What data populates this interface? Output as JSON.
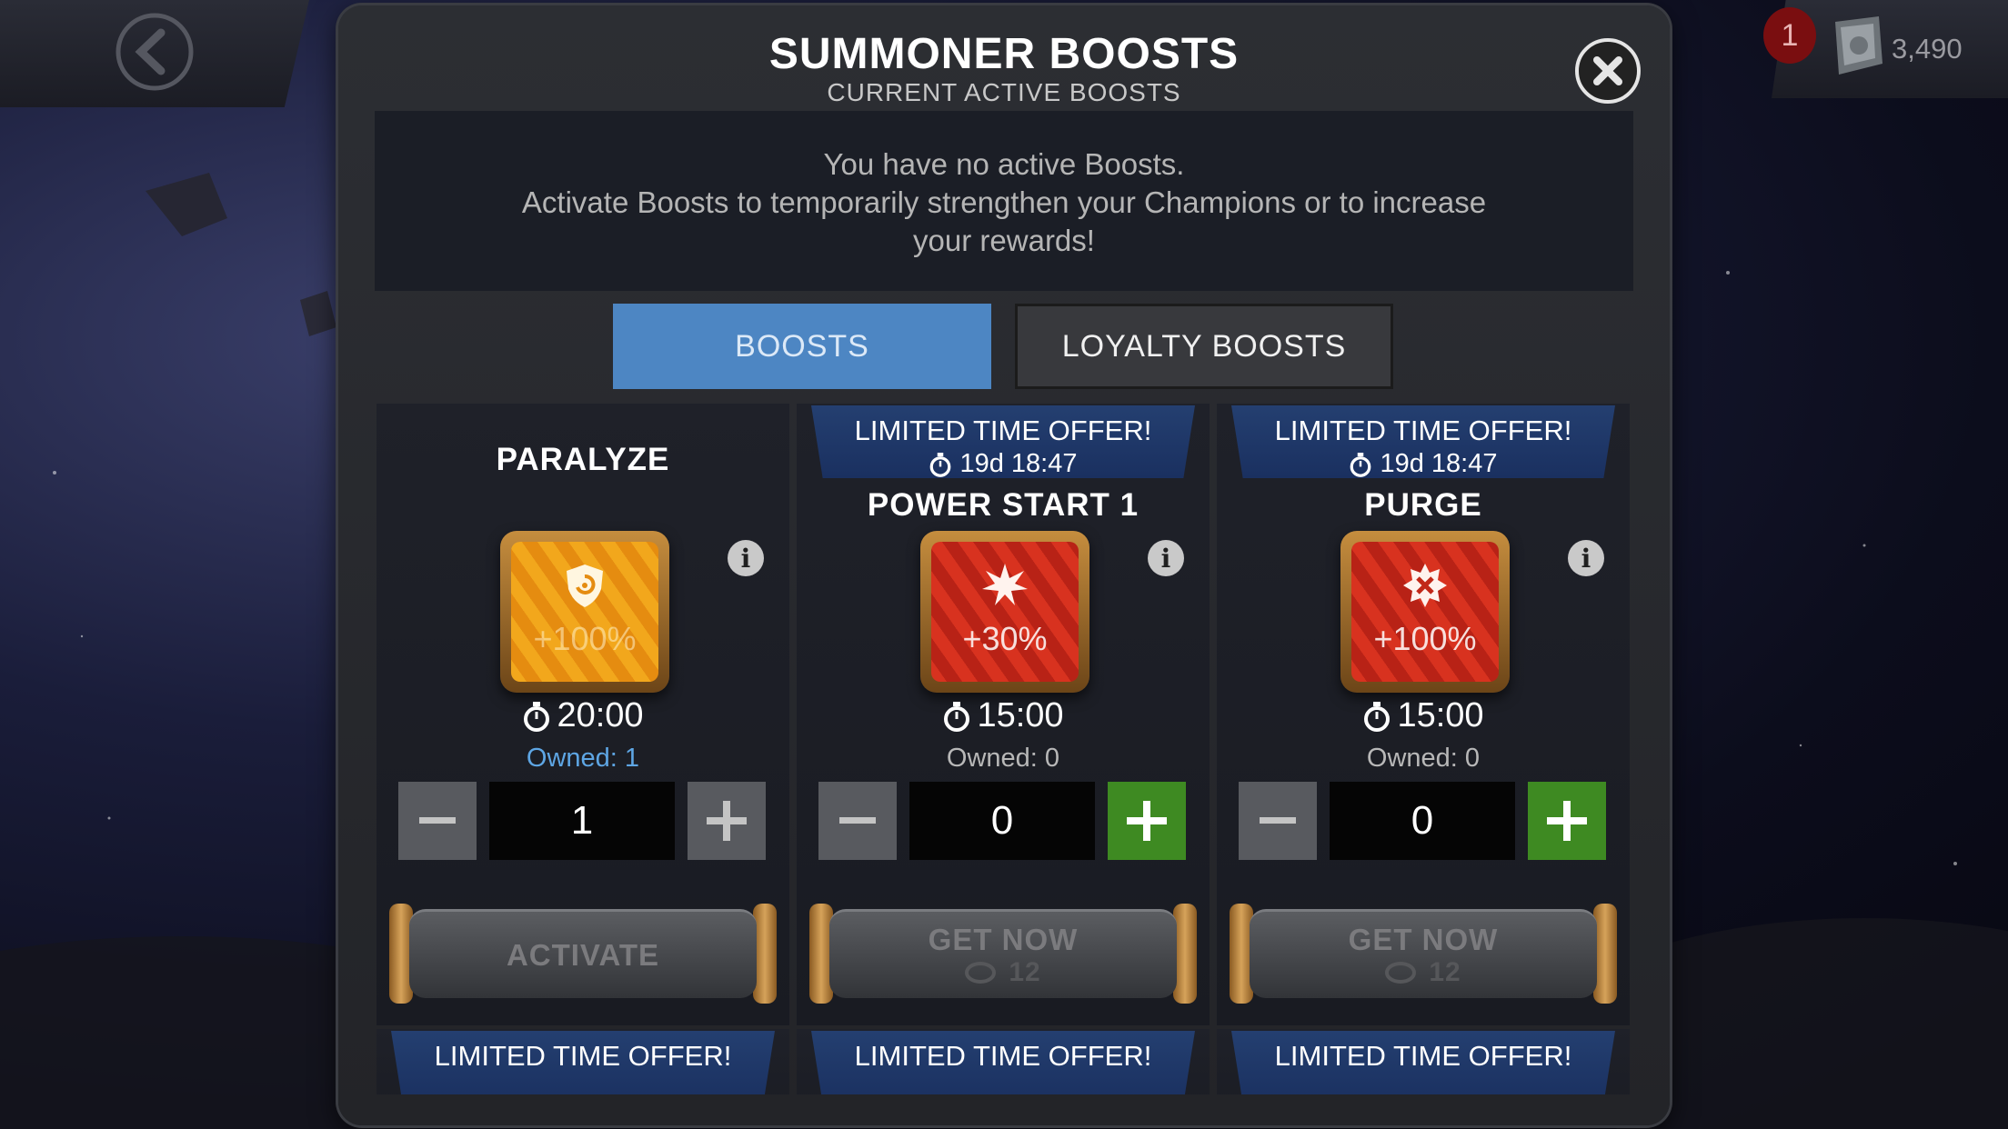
{
  "topbar": {
    "notification_count": "1",
    "currency_value": "3,490"
  },
  "modal": {
    "title": "SUMMONER BOOSTS",
    "subtitle": "CURRENT ACTIVE BOOSTS",
    "info_line1": "You have no active Boosts.",
    "info_line2": "Activate Boosts to temporarily strengthen your Champions or to increase",
    "info_line3": "your rewards!"
  },
  "tabs": [
    {
      "label": "BOOSTS",
      "active": true
    },
    {
      "label": "LOYALTY BOOSTS",
      "active": false
    }
  ],
  "boosts": [
    {
      "name": "PARALYZE",
      "banner": null,
      "icon": "shield-swirl-icon",
      "icon_theme": "gold",
      "percent": "+100%",
      "duration": "20:00",
      "owned": "Owned: 1",
      "quantity": "1",
      "action": "ACTIVATE",
      "price": ""
    },
    {
      "name": "POWER START 1",
      "banner": {
        "title": "LIMITED TIME OFFER!",
        "timer": "19d 18:47"
      },
      "icon": "power-burst-icon",
      "icon_theme": "red",
      "percent": "+30%",
      "duration": "15:00",
      "owned": "Owned: 0",
      "quantity": "0",
      "action": "GET NOW",
      "price": "12"
    },
    {
      "name": "PURGE",
      "banner": {
        "title": "LIMITED TIME OFFER!",
        "timer": "19d 18:47"
      },
      "icon": "purge-gear-icon",
      "icon_theme": "red",
      "percent": "+100%",
      "duration": "15:00",
      "owned": "Owned: 0",
      "quantity": "0",
      "action": "GET NOW",
      "price": "12"
    }
  ],
  "next_row_banners": [
    "LIMITED TIME OFFER!",
    "LIMITED TIME OFFER!",
    "LIMITED TIME OFFER!"
  ]
}
